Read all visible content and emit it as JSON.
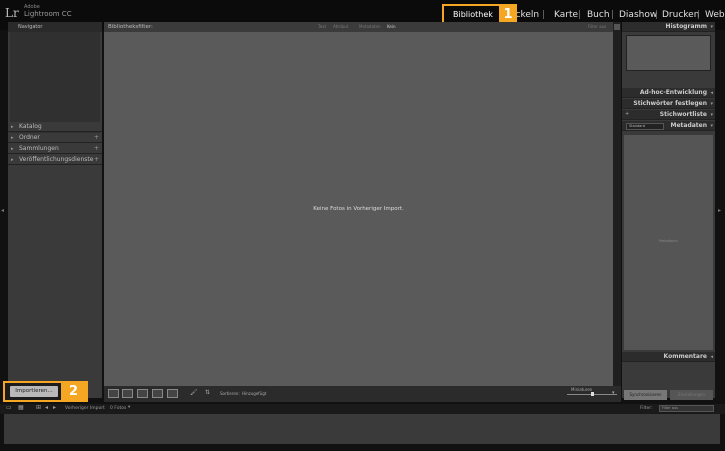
{
  "app": {
    "brand_small": "Adobe",
    "brand": "Lightroom CC",
    "logo": "Lr"
  },
  "modules": {
    "active": "Bibliothek",
    "items": [
      "ickeln",
      "Karte",
      "Buch",
      "Diashow",
      "Drucken",
      "Web"
    ],
    "separator": "|"
  },
  "badges": {
    "one": "1",
    "two": "2"
  },
  "left_panel": {
    "navigator": "Navigator",
    "items": [
      {
        "label": "Katalog"
      },
      {
        "label": "Ordner"
      },
      {
        "label": "Sammlungen"
      },
      {
        "label": "Veröffentlichungsdienste"
      }
    ],
    "import_label": "Importieren..."
  },
  "center": {
    "filter_title": "Bibliotheksfilter:",
    "filter_options": [
      "Text",
      "Attribut",
      "Metadaten",
      "Kein"
    ],
    "filter_preset": "Filter aus",
    "empty_message": "Keine Fotos in Vorheriger Import.",
    "toolbar_sort_label": "Sortieren:",
    "toolbar_sort_value": "Hinzugefügt",
    "toolbar_miniatures": "Miniaturen"
  },
  "right_panel": {
    "histogram": "Histogramm",
    "quick_develop": "Ad-hoc-Entwicklung",
    "keywording": "Stichwörter festlegen",
    "keyword_list": "Stichwortliste",
    "metadata": "Metadaten",
    "standard": "Standard",
    "metadata_placeholder": "Metadaten",
    "comments": "Kommentare",
    "sync_meta": "Synchronisieren",
    "sync_settings": "Einstellungen"
  },
  "filmstrip": {
    "source": "Vorheriger Import",
    "count": "0 Fotos",
    "filter_label": "Filter:",
    "filter_value": "Filter aus"
  },
  "colors": {
    "highlight": "#f5a623",
    "panel": "#3a3a3a",
    "center": "#5a5a5a"
  },
  "icons": [
    "grid-view-icon",
    "loupe-view-icon",
    "compare-view-icon",
    "survey-view-icon",
    "people-view-icon",
    "spray-can-icon",
    "sort-direction-icon",
    "nav-back-icon",
    "nav-forward-icon",
    "grid-small-icon"
  ]
}
